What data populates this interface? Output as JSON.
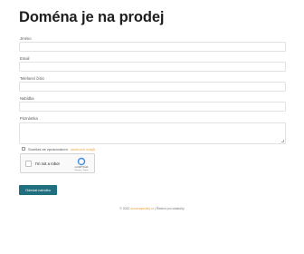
{
  "page": {
    "title": "Doména je na prodej"
  },
  "form": {
    "fields": [
      {
        "label": "Jméno",
        "value": ""
      },
      {
        "label": "Email",
        "value": ""
      },
      {
        "label": "Telefonní číslo",
        "value": ""
      },
      {
        "label": "Nabídka",
        "value": ""
      },
      {
        "label": "Poznámka",
        "value": ""
      }
    ],
    "consent": {
      "text": "Souhlas se zpracováním",
      "link": "osobních údajů"
    },
    "recaptcha": {
      "label": "I'm not a robot",
      "brand": "reCAPTCHA",
      "terms": "Privacy - Terms"
    },
    "submit_label": "Odeslat nabídku"
  },
  "footer": {
    "prefix": "© 2022",
    "link": "domenaprodej.cz",
    "suffix": " | Řešení pro vlastníky"
  },
  "colors": {
    "accent": "#1f6f7f",
    "link": "#e8a33a",
    "recaptcha_blue": "#4a90e2"
  }
}
